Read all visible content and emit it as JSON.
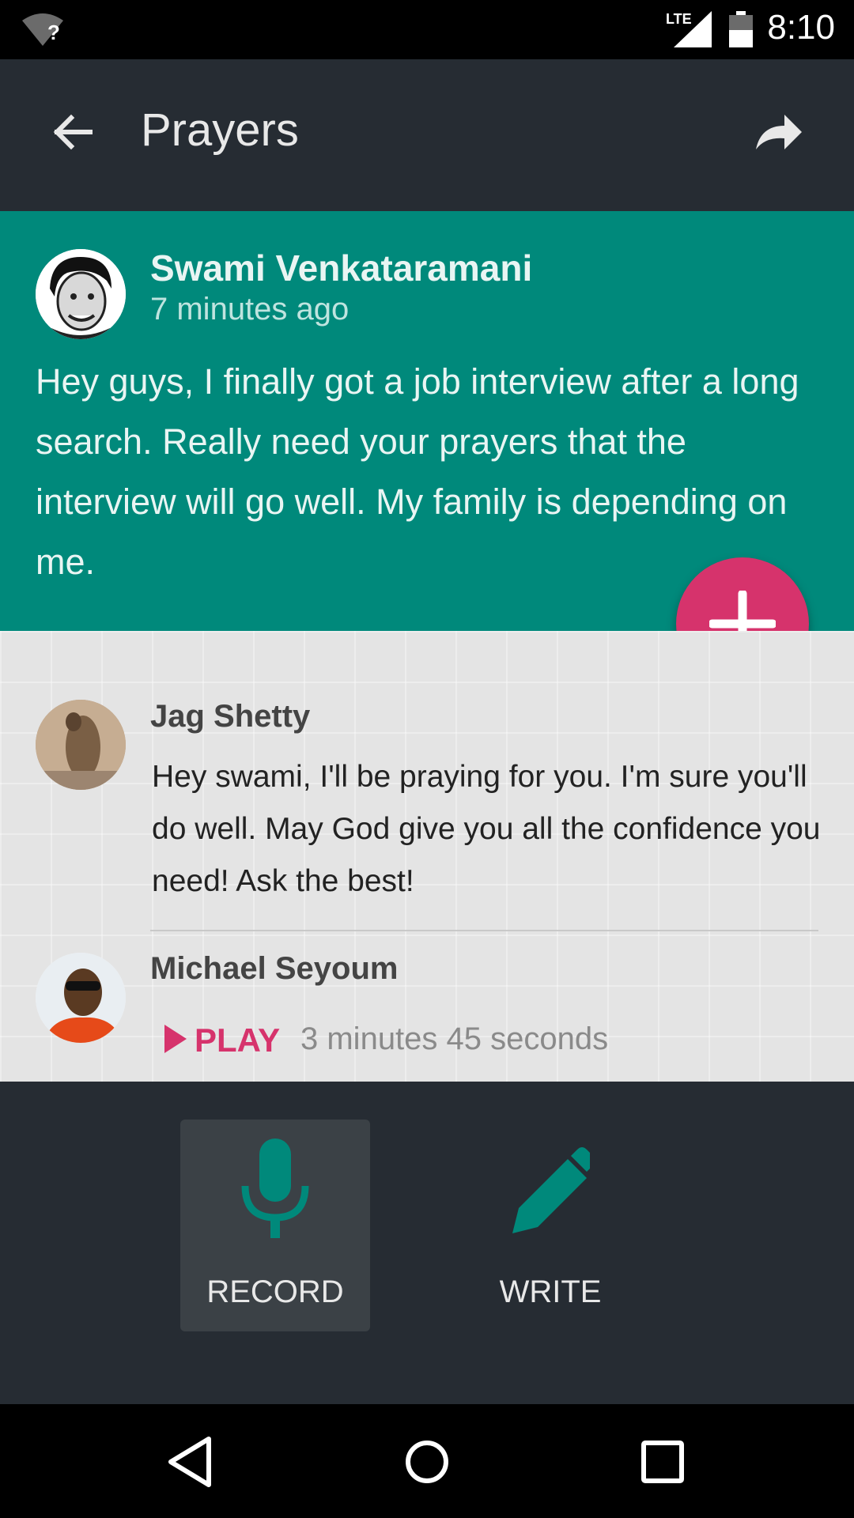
{
  "status_bar": {
    "time": "8:10",
    "network": "LTE",
    "wifi_unknown": "?",
    "icons": [
      "wifi-icon",
      "signal-icon",
      "battery-icon"
    ]
  },
  "toolbar": {
    "title": "Prayers",
    "back_icon": "arrow-left-icon",
    "share_icon": "share-icon"
  },
  "post": {
    "author": "Swami Venkataramani",
    "time": "7 minutes ago",
    "body": "Hey guys, I finally got a job interview after a long search. Really need your prayers that the interview will go well. My family is depending on me.",
    "background": "#00897b"
  },
  "fab": {
    "icon": "plus-icon",
    "color": "#d6336c"
  },
  "comments": [
    {
      "author": "Jag Shetty",
      "text": "Hey swami, I'll be praying for you. I'm sure you'll do well. May God give you all the confidence you need! Ask the best!"
    },
    {
      "author": "Michael Seyoum",
      "play_label": "PLAY",
      "duration": "3 minutes 45 seconds"
    }
  ],
  "actions": {
    "record": {
      "label": "RECORD",
      "icon": "microphone-icon"
    },
    "write": {
      "label": "WRITE",
      "icon": "pencil-icon"
    },
    "accent": "#00897b"
  },
  "nav_bar": {
    "icons": [
      "nav-back-icon",
      "nav-home-icon",
      "nav-recents-icon"
    ]
  }
}
